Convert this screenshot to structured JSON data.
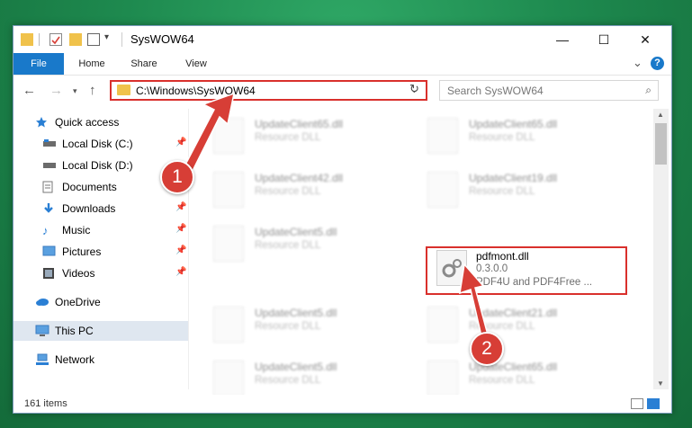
{
  "window": {
    "title": "SysWOW64",
    "controls": {
      "minimize": "—",
      "maximize": "☐",
      "close": "✕"
    }
  },
  "ribbon": {
    "tabs": [
      "File",
      "Home",
      "Share",
      "View"
    ],
    "expand": "⌄",
    "help": "?"
  },
  "address_bar": {
    "path": "C:\\Windows\\SysWOW64",
    "search_placeholder": "Search SysWOW64"
  },
  "nav_pane": {
    "items": [
      {
        "label": "Quick access",
        "icon": "star-icon"
      },
      {
        "label": "Local Disk (C:)",
        "icon": "drive-icon",
        "pinned": true
      },
      {
        "label": "Local Disk (D:)",
        "icon": "drive-icon"
      },
      {
        "label": "Documents",
        "icon": "documents-icon",
        "pinned": true
      },
      {
        "label": "Downloads",
        "icon": "downloads-icon",
        "pinned": true
      },
      {
        "label": "Music",
        "icon": "music-icon",
        "pinned": true
      },
      {
        "label": "Pictures",
        "icon": "pictures-icon",
        "pinned": true
      },
      {
        "label": "Videos",
        "icon": "videos-icon",
        "pinned": true
      },
      {
        "label": "OneDrive",
        "icon": "cloud-icon"
      },
      {
        "label": "This PC",
        "icon": "computer-icon",
        "selected": true
      },
      {
        "label": "Network",
        "icon": "network-icon"
      }
    ]
  },
  "files": [
    {
      "name": "UpdateClient65.dll",
      "sub1": "Resource DLL"
    },
    {
      "name": "UpdateClient65.dll",
      "sub1": "Resource DLL"
    },
    {
      "name": "UpdateClient42.dll",
      "sub1": "Resource DLL"
    },
    {
      "name": "UpdateClient19.dll",
      "sub1": "Resource DLL"
    },
    {
      "name": "UpdateClient5.dll",
      "sub1": "Resource DLL"
    },
    {
      "name": "pdfmont.dll",
      "sub1": "0.3.0.0",
      "sub2": "PDF4U and PDF4Free ..."
    },
    {
      "name": "UpdateClient5.dll",
      "sub1": "Resource DLL"
    },
    {
      "name": "UpdateClient21.dll",
      "sub1": "Resource DLL"
    },
    {
      "name": "UpdateClient5.dll",
      "sub1": "Resource DLL"
    },
    {
      "name": "UpdateClient65.dll",
      "sub1": "Resource DLL"
    }
  ],
  "status": {
    "item_count": "161 items"
  },
  "callouts": {
    "one": "1",
    "two": "2"
  },
  "colors": {
    "accent": "#1979ca",
    "highlight": "#d9302c"
  }
}
